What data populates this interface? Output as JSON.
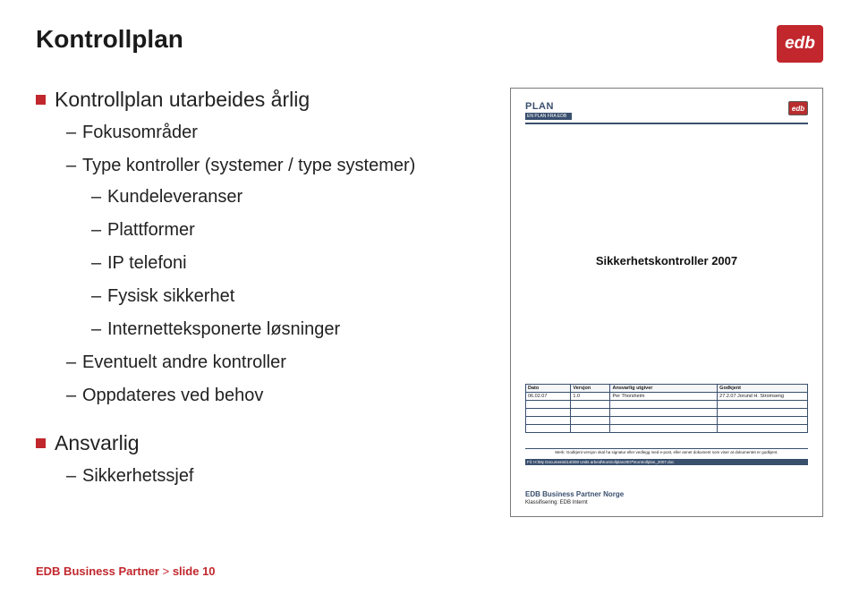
{
  "header": {
    "title": "Kontrollplan",
    "logo_text": "edb"
  },
  "left": {
    "bullet1": "Kontrollplan utarbeides årlig",
    "sub": {
      "fokus": "Fokusområder",
      "type_kontroller": "Type kontroller (systemer / type systemer)",
      "kundeleveranser": "Kundeleveranser",
      "plattformer": "Plattformer",
      "ip_telefoni": "IP telefoni",
      "fysisk": "Fysisk sikkerhet",
      "internet": "Internetteksponerte løsninger",
      "eventuelt": "Eventuelt andre kontroller",
      "oppdateres": "Oppdateres ved behov"
    },
    "bullet2": "Ansvarlig",
    "sub2": {
      "sikkerhetssjef": "Sikkerhetssjef"
    }
  },
  "doc": {
    "plan_label": "PLAN",
    "plan_sub": "EN PLAN FRA EDB",
    "logo_text": "edb",
    "title": "Sikkerhetskontroller 2007",
    "table": {
      "h1": "Dato",
      "h2": "Versjon",
      "h3": "Ansvarlig utgiver",
      "h4": "Godkjent",
      "r1c1": "06.02.07",
      "r1c2": "1.0",
      "r1c3": "Per Thorsheim",
      "r1c4": "27.2.07 Jorund H. Stromseng"
    },
    "note": "Merk: Godkjent versjon skal ha signatur eller vedlegg med e-post, eller annet dokument som viser at dokumentet er godkjent.",
    "path": "Fil: H:\\My Documents\\140\\00 Units arbeid\\Kontrollplan2007\\Kontrollplan_2007.doc",
    "company": "EDB Business Partner Norge",
    "klass": "Klassifisering: EDB Internt"
  },
  "footer": {
    "company": "EDB Business Partner",
    "sep": " > ",
    "slide": "slide 10"
  }
}
